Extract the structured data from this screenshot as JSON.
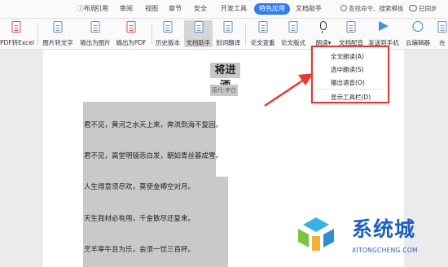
{
  "tabs": [
    {
      "label": "ⓘ布局",
      "active": false
    },
    {
      "label": "引用",
      "active": false
    },
    {
      "label": "审阅",
      "active": false
    },
    {
      "label": "视图",
      "active": false
    },
    {
      "label": "章节",
      "active": false
    },
    {
      "label": "安全",
      "active": false
    },
    {
      "label": "开发工具",
      "active": false
    },
    {
      "label": "特色应用",
      "active": true
    },
    {
      "label": "文档助手",
      "active": false
    }
  ],
  "search_label": "查找命令、搜索模板",
  "share_label": "已同步",
  "toolbar": [
    {
      "label": "PDF转Excel",
      "icon": "pdf-to-excel-icon"
    },
    {
      "label": "图片转文字",
      "icon": "image-to-text-icon"
    },
    {
      "label": "输出为图片",
      "icon": "export-image-icon"
    },
    {
      "label": "输出为PDF",
      "icon": "export-pdf-icon"
    },
    {
      "label": "历史版本",
      "icon": "history-icon"
    },
    {
      "label": "文档助手",
      "icon": "doc-assistant-icon"
    },
    {
      "label": "划词翻译",
      "icon": "translate-icon"
    },
    {
      "label": "论文查重",
      "icon": "plagiarism-check-icon"
    },
    {
      "label": "论文版式",
      "icon": "paper-format-icon"
    },
    {
      "label": "朗读▾",
      "icon": "microphone-icon"
    },
    {
      "label": "文档配音",
      "icon": "dubbing-icon"
    },
    {
      "label": "发送到手机",
      "icon": "send-to-phone-icon"
    },
    {
      "label": "云编辑器",
      "icon": "cloud-editor-icon"
    },
    {
      "label": "在",
      "icon": "more-icon"
    }
  ],
  "document": {
    "title": "将进酒",
    "author": "唐代·李白",
    "lines": [
      "君不见，黄河之水天上来，奔流到海不复回。",
      "君不见，高堂明镜悲白发，朝如青丝暮成雪。",
      "人生得意须尽欢，莫使金樽空对月。",
      "天生我材必有用，千金散尽还复来。",
      "烹羊宰牛且为乐，会须一饮三百杯。"
    ]
  },
  "read_menu": {
    "items": [
      "全文朗读(A)",
      "选中朗读(S)",
      "输出语音(O)",
      "显示工具栏(D)"
    ]
  },
  "watermark": {
    "title": "系统城",
    "subtitle": "XITONGCHENG.COM"
  },
  "colors": {
    "accent": "#2f7af5",
    "highlight_box": "#e53935",
    "watermark": "#1f5fc4"
  }
}
